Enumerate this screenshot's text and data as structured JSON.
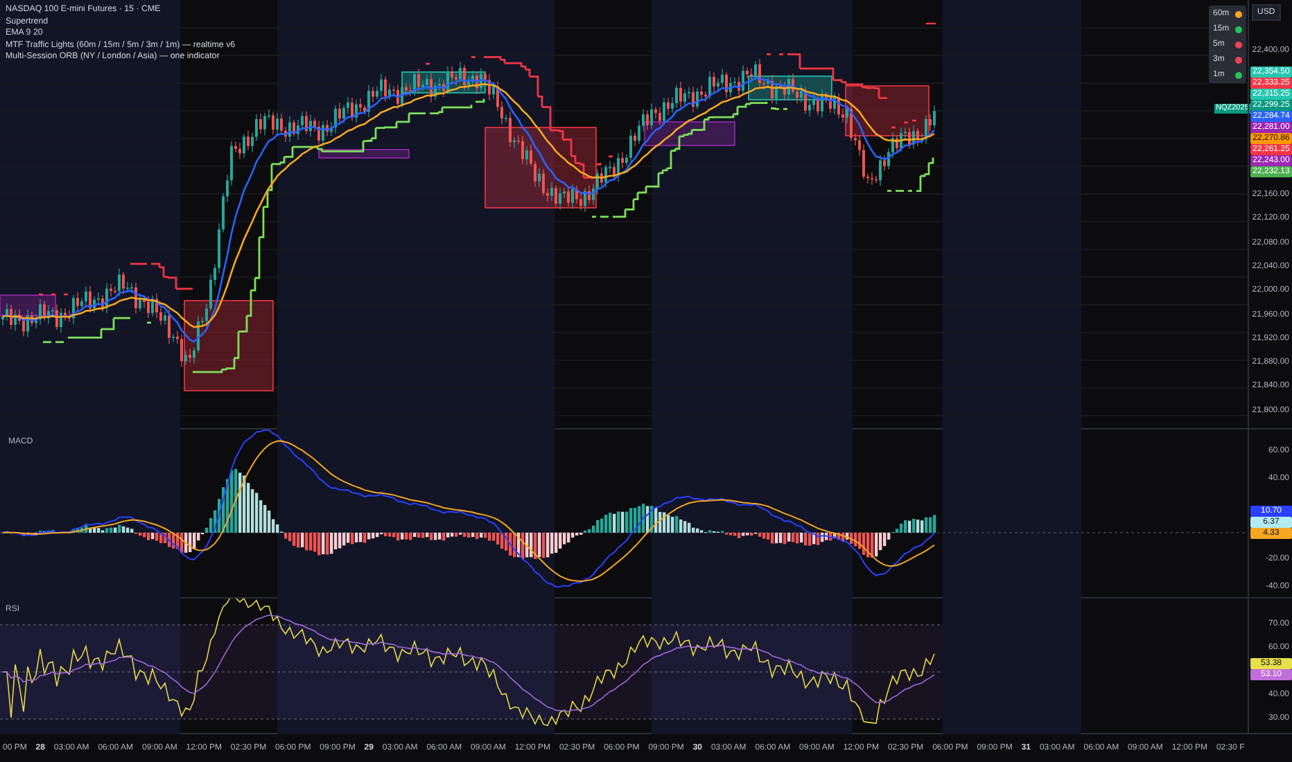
{
  "legend": {
    "title": "NASDAQ 100 E-mini Futures · 15 · CME",
    "indicators": [
      "Supertrend",
      "EMA 9 20",
      "MTF Traffic Lights (60m / 15m / 5m / 3m / 1m) — realtime v6",
      "Multi-Session ORB (NY / London / Asia) — one indicator"
    ]
  },
  "traffic_lights": [
    {
      "label": "60m",
      "color": "#f5a623"
    },
    {
      "label": "15m",
      "color": "#22c55e"
    },
    {
      "label": "5m",
      "color": "#ef4455"
    },
    {
      "label": "3m",
      "color": "#ef4455"
    },
    {
      "label": "1m",
      "color": "#22c55e"
    }
  ],
  "symbol_tag": "NQZ2025",
  "price_axis": {
    "currency": "USD",
    "ticks": [
      "22,400.00",
      "22,160.00",
      "22,120.00",
      "22,080.00",
      "22,040.00",
      "22,000.00",
      "21,960.00",
      "21,920.00",
      "21,880.00",
      "21,840.00",
      "21,800.00"
    ],
    "labels": [
      {
        "text": "22,354.50",
        "color": "#26c6b0"
      },
      {
        "text": "22,333.25",
        "color": "#f23645"
      },
      {
        "text": "22,315.25",
        "color": "#26c6b0"
      },
      {
        "text": "22,299.25",
        "color": "#089981"
      },
      {
        "text": "22,284.74",
        "color": "#2962ff"
      },
      {
        "text": "22,281.00",
        "color": "#9c27b0"
      },
      {
        "text": "22,270.86",
        "color": "#ff9800"
      },
      {
        "text": "22,261.25",
        "color": "#f23645"
      },
      {
        "text": "22,243.00",
        "color": "#9c27b0"
      },
      {
        "text": "22,232.13",
        "color": "#4caf50"
      }
    ]
  },
  "macd": {
    "title": "MACD",
    "ticks": [
      "60.00",
      "40.00",
      "-20.00",
      "-40.00"
    ],
    "labels": [
      {
        "text": "10.70",
        "color": "#2940ff"
      },
      {
        "text": "6.37",
        "color": "#b2ebf2"
      },
      {
        "text": "4.33",
        "color": "#f5a623"
      }
    ]
  },
  "rsi": {
    "title": "RSI",
    "ticks": [
      "70.00",
      "60.00",
      "40.00",
      "30.00"
    ],
    "labels": [
      {
        "text": "53.38",
        "color": "#e6e04a"
      },
      {
        "text": "53.10",
        "color": "#c06ed8"
      }
    ]
  },
  "time_axis": [
    {
      "text": "00 PM",
      "kind": "time"
    },
    {
      "text": "28",
      "kind": "date"
    },
    {
      "text": "03:00 AM",
      "kind": "time"
    },
    {
      "text": "06:00 AM",
      "kind": "time"
    },
    {
      "text": "09:00 AM",
      "kind": "time"
    },
    {
      "text": "12:00 PM",
      "kind": "time"
    },
    {
      "text": "02:30 PM",
      "kind": "time"
    },
    {
      "text": "06:00 PM",
      "kind": "time"
    },
    {
      "text": "09:00 PM",
      "kind": "time"
    },
    {
      "text": "29",
      "kind": "date"
    },
    {
      "text": "03:00 AM",
      "kind": "time"
    },
    {
      "text": "06:00 AM",
      "kind": "time"
    },
    {
      "text": "09:00 AM",
      "kind": "time"
    },
    {
      "text": "12:00 PM",
      "kind": "time"
    },
    {
      "text": "02:30 PM",
      "kind": "time"
    },
    {
      "text": "06:00 PM",
      "kind": "time"
    },
    {
      "text": "09:00 PM",
      "kind": "time"
    },
    {
      "text": "30",
      "kind": "date"
    },
    {
      "text": "03:00 AM",
      "kind": "time"
    },
    {
      "text": "06:00 AM",
      "kind": "time"
    },
    {
      "text": "09:00 AM",
      "kind": "time"
    },
    {
      "text": "12:00 PM",
      "kind": "time"
    },
    {
      "text": "02:30 PM",
      "kind": "time"
    },
    {
      "text": "06:00 PM",
      "kind": "time"
    },
    {
      "text": "09:00 PM",
      "kind": "time"
    },
    {
      "text": "31",
      "kind": "date"
    },
    {
      "text": "03:00 AM",
      "kind": "time"
    },
    {
      "text": "06:00 AM",
      "kind": "time"
    },
    {
      "text": "09:00 AM",
      "kind": "time"
    },
    {
      "text": "12:00 PM",
      "kind": "time"
    },
    {
      "text": "02:30 F",
      "kind": "time"
    }
  ]
}
